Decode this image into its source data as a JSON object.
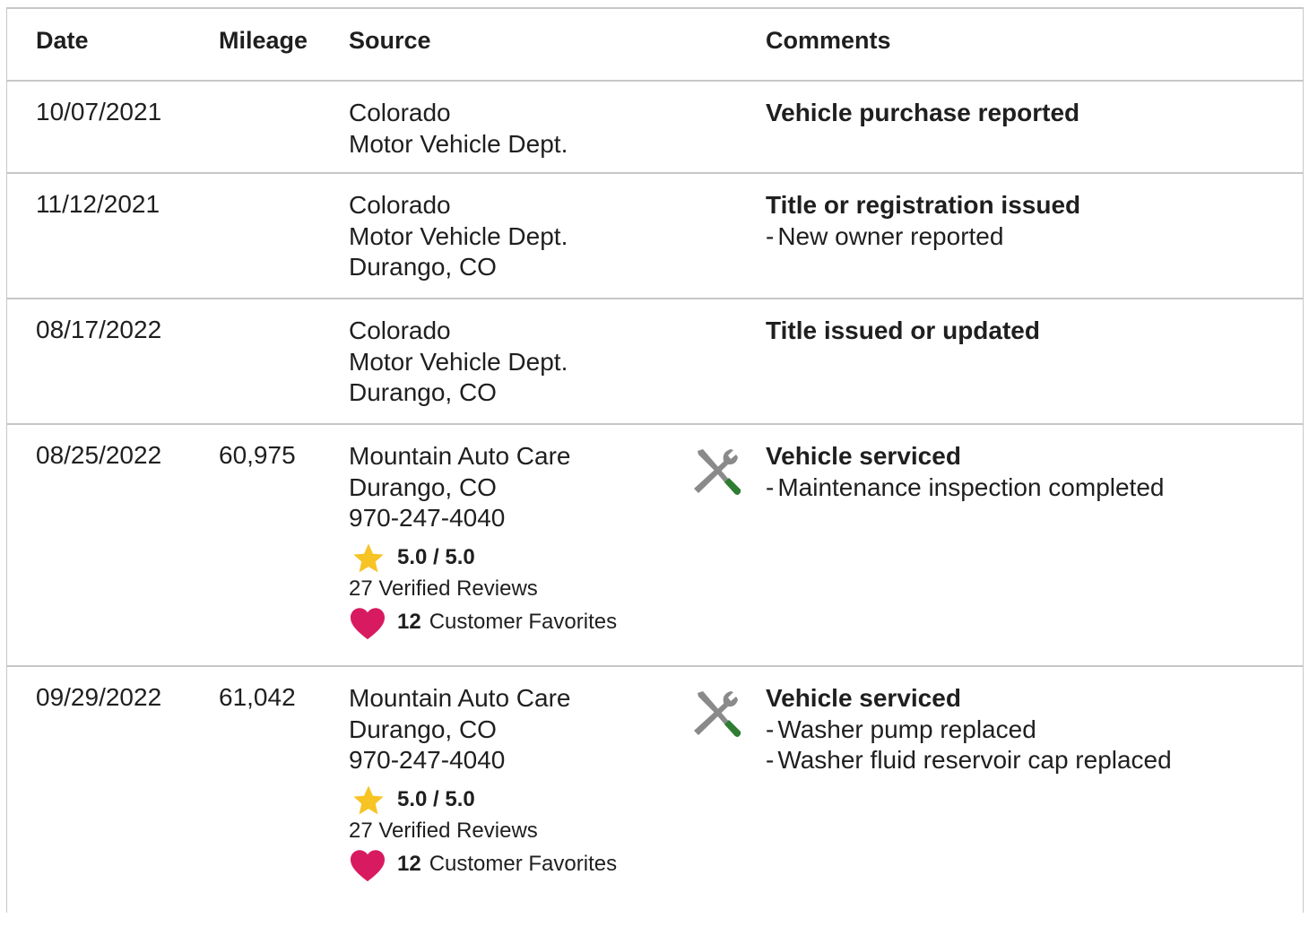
{
  "headers": {
    "date": "Date",
    "mileage": "Mileage",
    "source": "Source",
    "comments": "Comments"
  },
  "colors": {
    "border": "#c7c7c7",
    "star": "#f7c325",
    "heart": "#d81b60",
    "wrench": "#8a8a8a",
    "screwdriver_handle": "#2e7d32"
  },
  "rows": [
    {
      "date": "10/07/2021",
      "mileage": "",
      "source": [
        "Colorado",
        "Motor Vehicle Dept."
      ],
      "comment_title": "Vehicle purchase reported",
      "comment_items": []
    },
    {
      "date": "11/12/2021",
      "mileage": "",
      "source": [
        "Colorado",
        "Motor Vehicle Dept.",
        "Durango, CO"
      ],
      "comment_title": "Title or registration issued",
      "comment_items": [
        "New owner reported"
      ]
    },
    {
      "date": "08/17/2022",
      "mileage": "",
      "source": [
        "Colorado",
        "Motor Vehicle Dept.",
        "Durango, CO"
      ],
      "comment_title": "Title issued or updated",
      "comment_items": []
    },
    {
      "date": "08/25/2022",
      "mileage": "60,975",
      "source": [
        "Mountain Auto Care",
        "Durango, CO",
        "970-247-4040"
      ],
      "rating": "5.0 / 5.0",
      "reviews": "27 Verified Reviews",
      "favorites_count": "12",
      "favorites_label": "Customer Favorites",
      "icon": "service-tools-icon",
      "comment_title": "Vehicle serviced",
      "comment_items": [
        "Maintenance inspection completed"
      ]
    },
    {
      "date": "09/29/2022",
      "mileage": "61,042",
      "source": [
        "Mountain Auto Care",
        "Durango, CO",
        "970-247-4040"
      ],
      "rating": "5.0 / 5.0",
      "reviews": "27 Verified Reviews",
      "favorites_count": "12",
      "favorites_label": "Customer Favorites",
      "icon": "service-tools-icon",
      "comment_title": "Vehicle serviced",
      "comment_items": [
        "Washer pump replaced",
        "Washer fluid reservoir cap replaced"
      ]
    }
  ]
}
